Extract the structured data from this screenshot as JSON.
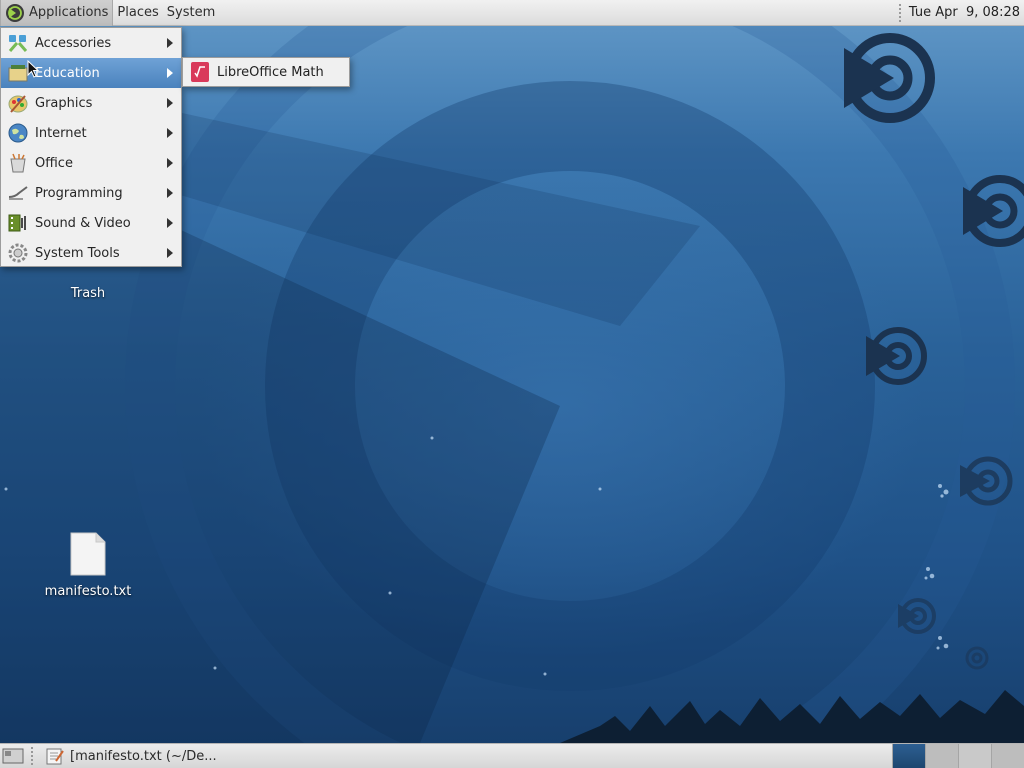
{
  "top_panel": {
    "menus": [
      {
        "label": "Applications",
        "icon": "distro-logo-icon"
      },
      {
        "label": "Places"
      },
      {
        "label": "System"
      }
    ],
    "clock": "Tue Apr  9, 08:28"
  },
  "applications_menu": {
    "items": [
      {
        "label": "Accessories",
        "icon": "accessories-icon"
      },
      {
        "label": "Education",
        "icon": "education-icon",
        "highlighted": true
      },
      {
        "label": "Graphics",
        "icon": "graphics-icon"
      },
      {
        "label": "Internet",
        "icon": "internet-icon"
      },
      {
        "label": "Office",
        "icon": "office-icon"
      },
      {
        "label": "Programming",
        "icon": "programming-icon"
      },
      {
        "label": "Sound & Video",
        "icon": "sound-video-icon"
      },
      {
        "label": "System Tools",
        "icon": "system-tools-icon"
      }
    ]
  },
  "education_submenu": {
    "items": [
      {
        "label": "LibreOffice Math",
        "icon": "libreoffice-math-icon"
      }
    ]
  },
  "desktop": {
    "icons": [
      {
        "label": "Trash",
        "icon": "trash-icon"
      },
      {
        "label": "manifesto.txt",
        "icon": "text-file-icon"
      }
    ]
  },
  "bottom_panel": {
    "tasks": [
      {
        "label": "[manifesto.txt (~/De...",
        "icon": "text-editor-icon"
      }
    ],
    "workspaces": 4,
    "active_workspace": 1
  },
  "colors": {
    "menu_highlight": "#5b93cc",
    "wallpaper_blue": "#2a6299",
    "panel_bg": "#e2e2e2"
  }
}
